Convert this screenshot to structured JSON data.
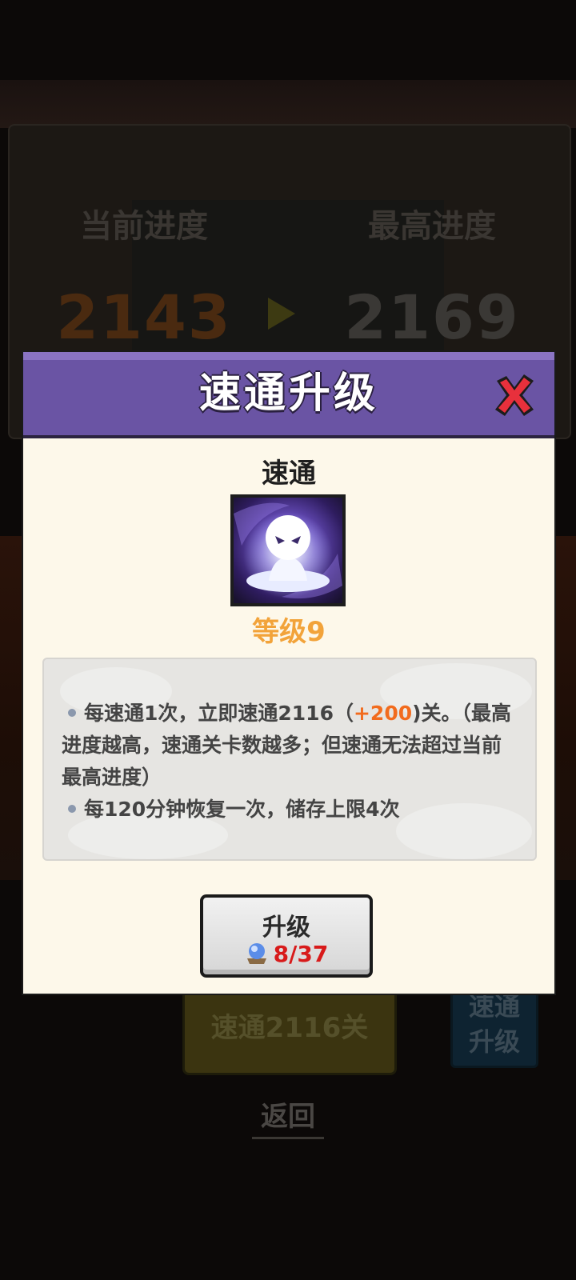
{
  "background": {
    "current_progress_label": "当前进度",
    "best_progress_label": "最高进度",
    "current_progress_value": "2143",
    "best_progress_value": "2169",
    "skip_button_label": "速通2116关",
    "upgrade_button_label": "速通升级",
    "back_link_label": "返回"
  },
  "dialog": {
    "title": "速通升级",
    "skill_name": "速通",
    "skill_level": "等级9",
    "description": {
      "line1_prefix": "每速通1次，立即速通2116（",
      "line1_bonus": "+200",
      "line1_suffix": ")关。（最高进度越高，速通关卡数越多；但速通无法超过当前最高进度）",
      "line2": "每120分钟恢复一次，储存上限4次"
    },
    "upgrade_button": {
      "label": "升级",
      "cost": "8/37"
    }
  },
  "icons": {
    "close": "close-x-icon",
    "arrow": "arrow-right-icon",
    "skill": "meditating-spirit-icon",
    "currency": "crystal-ball-icon"
  },
  "colors": {
    "header_purple": "#6a54a4",
    "dialog_bg": "#fdf8ea",
    "level_orange": "#f2a33a",
    "bonus_orange": "#f26b1d",
    "cost_red": "#d81a1a"
  }
}
